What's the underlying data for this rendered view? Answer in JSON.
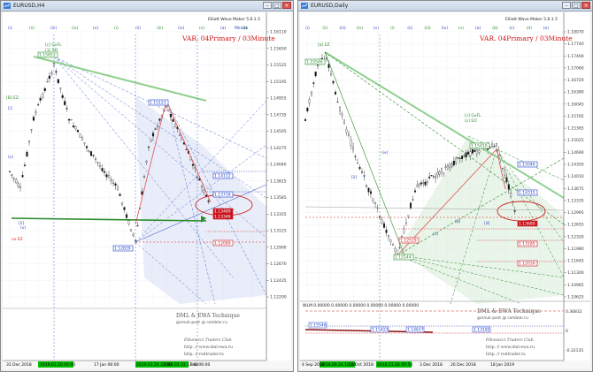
{
  "left_window": {
    "title": "EURUSD,H4",
    "maker_label": "Elliott Wave Maker 5.6.1.5",
    "var_label": "VAR. 04Primary / 03Minute",
    "minute_label": "Minute",
    "top_waves": [
      "(i)",
      "(ii)",
      "(iii)",
      "(iv)",
      "(v)",
      "(i)",
      "(ii)",
      "(iii)",
      "(iv)",
      "(v)",
      "(a)",
      "(b)"
    ],
    "price_ticks": [
      "1.16110",
      "1.15650",
      "1.15525",
      "1.15195",
      "1.14955",
      "1.14735",
      "1.14505",
      "1.14275",
      "1.14040",
      "1.13815",
      "1.13585",
      "1.13355",
      "1.13125",
      "1.12900",
      "1.12670",
      "1.12435",
      "1.12200"
    ],
    "price_boxes": [
      "1.15653",
      "1.15123",
      "1.14112",
      "1.13718",
      "1.13489",
      "1.13346",
      "1.12839",
      "1.12089"
    ],
    "wave_labels": {
      "c_or_top": "[c] GxFL",
      "one_top": "(1) SD",
      "b_left": "[B] EZ",
      "hz": "vv EZ",
      "w": "(v)",
      "iii": "[i]",
      "ii": "[ii]",
      "v": "(v)"
    },
    "time_ticks": [
      "31 Dec 2018",
      "",
      "17 Jan 06:00",
      "",
      "",
      "Feb 06:00"
    ],
    "time_highlights": [
      "2019.01.10 05:00",
      "2019.01.24 21:00",
      "2019.01.31 13:00"
    ],
    "footer": {
      "brand": "DML & EWA Technique",
      "email": "gornuk-post @ rambler.ru",
      "fib": "Fibonacci   Traders   Club",
      "site1": "http: // www.dml-ewa.ru",
      "site2": "http: // redtrader.ru"
    }
  },
  "right_window": {
    "title": "EURUSD,Daily",
    "maker_label": "Elliott Wave Maker 5.6.1.5",
    "var_label": "VAR. 04Primary / 03Minute",
    "top_waves": [
      "(i)",
      "(ii)",
      "(iii)",
      "(iv)",
      "(v)",
      "(i)",
      "(ii)",
      "(iii)",
      "(iv)",
      "(v)",
      "(a)",
      "(b)",
      "(c)",
      "(d)",
      "(e)"
    ],
    "price_ticks": [
      "1.18070",
      "1.17740",
      "1.17400",
      "1.17060",
      "1.16720",
      "1.16380",
      "1.16045",
      "1.15705",
      "1.15365",
      "1.15025",
      "1.14690",
      "1.14350",
      "1.14010",
      "1.13675",
      "1.13335",
      "1.12995",
      "1.12655",
      "1.12320",
      "1.11980",
      "1.11645",
      "1.11300",
      "1.10965",
      "1.10625"
    ],
    "price_boxes": [
      "1.15546",
      "1.15410",
      "1.15046",
      "1.14315",
      "1.13680",
      "1.12144",
      "1.13185",
      "1.12519",
      "1.12039"
    ],
    "wave_labels": {
      "top": "[a] EZ",
      "c_mid": "[c] GxFL",
      "c_eo": "(c) EO",
      "ii": "(iv)",
      "iii": "[ii]",
      "v": "(v)",
      "b": "(b)",
      "d": "[d]"
    },
    "indicator": {
      "header": "WLM 0.00000 0.00000 0.00000 0.00000 0.00000 0.00000",
      "ticks": [
        "0.36832",
        "0",
        "-0.32135"
      ],
      "boxes": [
        "1.15546",
        "1.15423",
        "1.14617",
        "1.13185"
      ]
    },
    "time_ticks": [
      "4 Sep 2018",
      "18 Oct 2018",
      "3 Dec 2018",
      "26 Dec 2018",
      "18 Jan 2019"
    ],
    "time_highlights": [
      "2018.09.24 10:24",
      "2018.11.26 00:54"
    ],
    "footer": {
      "brand": "DML & EWA Technique",
      "email": "gornuk-post @ rambler.ru",
      "fib": "Fibonacci   Traders   Club",
      "site1": "http: // www.dml-ewa.ru",
      "site2": "http: // redtrader.ru"
    }
  },
  "colors": {
    "bg": "#ffffff",
    "blue_box": "#1e3fc8",
    "red_box": "#c8141e",
    "green_box": "#2a8a2a",
    "var_red": "#d01010",
    "highlight": "#00c000"
  },
  "icons": [
    "app-icon",
    "minimize-icon",
    "maximize-icon",
    "close-icon"
  ]
}
